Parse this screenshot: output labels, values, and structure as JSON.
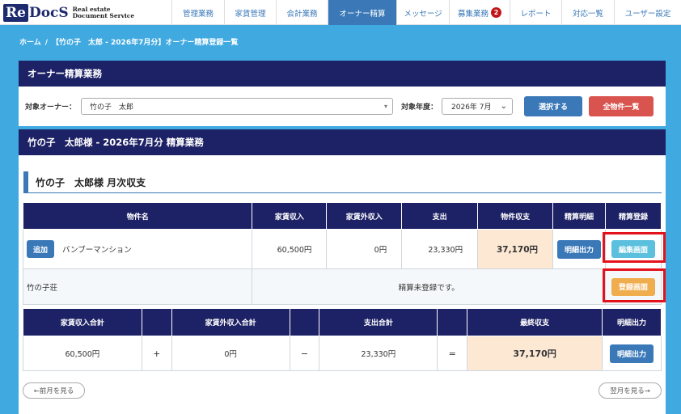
{
  "header": {
    "logo_re": "Re",
    "logo_docs": "DocS",
    "logo_sub1": "Real estate",
    "logo_sub2": "Document Service",
    "nav": [
      {
        "label": "管理業務"
      },
      {
        "label": "家賃管理"
      },
      {
        "label": "会計業務"
      },
      {
        "label": "オーナー精算"
      },
      {
        "label": "メッセージ"
      },
      {
        "label": "募集業務",
        "badge": "2"
      },
      {
        "label": "レポート"
      },
      {
        "label": "対応一覧"
      },
      {
        "label": "ユーザー設定"
      }
    ]
  },
  "breadcrumb": {
    "home": "ホーム",
    "sep": "/",
    "current": "【竹の子　太郎 - 2026年7月分】オーナー精算登録一覧"
  },
  "panel1": {
    "title": "オーナー精算業務",
    "owner_label": "対象オーナー：",
    "owner_value": "竹の子　太郎",
    "year_label": "対象年度：",
    "year_value": "2026年 7月",
    "select_btn": "選択する",
    "all_btn": "全物件一覧"
  },
  "panel2": {
    "title": "竹の子　太郎様 - 2026年7月分 精算業務",
    "section_title": "竹の子　太郎様 月次収支"
  },
  "table1": {
    "headers": [
      "物件名",
      "家賃収入",
      "家賃外収入",
      "支出",
      "物件収支",
      "精算明細",
      "精算登録"
    ],
    "row1": {
      "add_btn": "追加",
      "name": "バンブーマンション",
      "rent": "60,500円",
      "other": "0円",
      "expense": "23,330円",
      "balance": "37,170円",
      "detail_btn": "明細出力",
      "edit_btn": "編集画面"
    },
    "row2": {
      "name": "竹の子荘",
      "status": "精算未登録です。",
      "register_btn": "登録画面"
    }
  },
  "table2": {
    "headers": [
      "家賃収入合計",
      "家賃外収入合計",
      "支出合計",
      "最終収支",
      "明細出力"
    ],
    "rent_total": "60,500円",
    "plus": "+",
    "other_total": "0円",
    "minus": "−",
    "expense_total": "23,330円",
    "equals": "=",
    "final": "37,170円",
    "detail_btn": "明細出力"
  },
  "pager": {
    "prev": "←前月を見る",
    "next": "翌月を見る→"
  },
  "colors": {
    "navy": "#1d2165",
    "blue_btn": "#3a78b8",
    "red_btn": "#d9534f",
    "cyan_btn": "#5bc0de",
    "orange_btn": "#f0ad4e",
    "highlight": "#e4121a",
    "background": "#3fa9e0"
  }
}
